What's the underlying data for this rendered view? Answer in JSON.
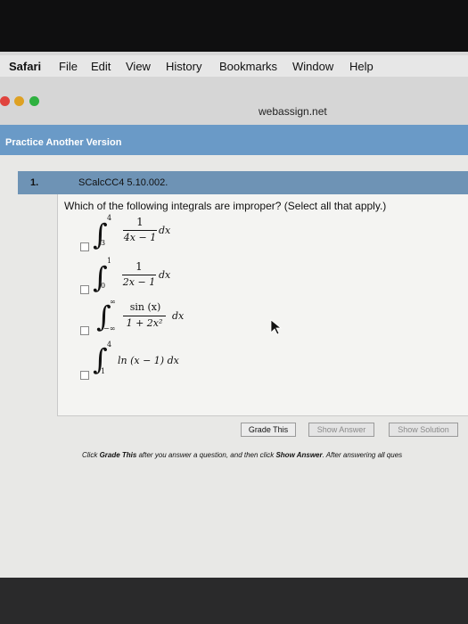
{
  "menubar": {
    "app": "Safari",
    "items": [
      "File",
      "Edit",
      "View",
      "History",
      "Bookmarks",
      "Window",
      "Help"
    ]
  },
  "browser": {
    "url": "webassign.net"
  },
  "practice": {
    "label": "Practice Another Version"
  },
  "question": {
    "number": "1.",
    "code": "SCalcCC4 5.10.002.",
    "prompt": "Which of the following integrals are improper? (Select all that apply.)",
    "options": [
      {
        "upper": "4",
        "lower": "3",
        "numerator": "1",
        "denominator": "4x − 1",
        "differential": "dx",
        "checked": false
      },
      {
        "upper": "1",
        "lower": "0",
        "numerator": "1",
        "denominator": "2x − 1",
        "differential": "dx",
        "checked": false
      },
      {
        "upper": "∞",
        "lower": "−∞",
        "numerator": "sin (x)",
        "denominator": "1 + 2x²",
        "differential": "dx",
        "checked": false
      },
      {
        "upper": "4",
        "lower": "1",
        "expression": "ln (x − 1) dx",
        "checked": false
      }
    ]
  },
  "buttons": {
    "grade": "Grade This",
    "show_answer": "Show Answer",
    "show_solution": "Show Solution"
  },
  "footnote": {
    "part1": "Click ",
    "grade_bold": "Grade This",
    "part2": " after you answer a question, and then click ",
    "show_bold": "Show Answer",
    "part3": ". After answering all ques"
  }
}
